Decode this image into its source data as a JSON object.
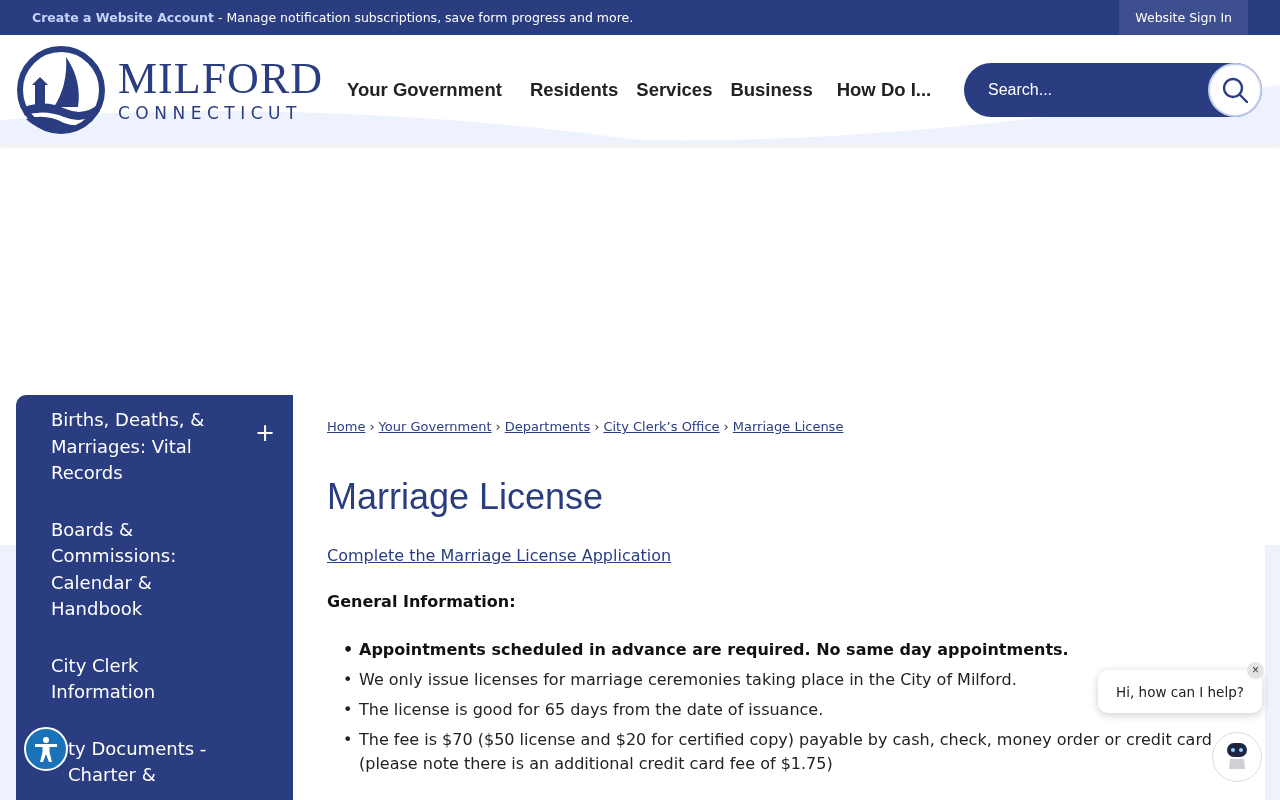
{
  "top_bar": {
    "account_link": "Create a Website Account",
    "account_note": "- Manage notification subscriptions, save form progress and more.",
    "sign_in": "Website Sign In"
  },
  "logo": {
    "name": "MILFORD",
    "state": "CONNECTICUT"
  },
  "nav": [
    "Your Government",
    "Residents",
    "Services",
    "Business",
    "How Do I..."
  ],
  "search": {
    "placeholder": "Search..."
  },
  "sidebar": {
    "items": [
      {
        "label": "Births, Deaths, & Marriages: Vital Records",
        "toggle": "+"
      },
      {
        "label": "Boards & Commissions: Calendar & Handbook"
      },
      {
        "label": "City Clerk Information"
      },
      {
        "label": "ty Documents - Charter &"
      }
    ]
  },
  "breadcrumb": [
    "Home",
    "Your Government",
    "Departments",
    "City Clerk’s Office",
    "Marriage License"
  ],
  "breadcrumb_separator": "›",
  "page_title": "Marriage License",
  "application_link": "Complete the Marriage License Application",
  "section_heading": "General Information:",
  "bullet_marker": "•",
  "bullets": [
    {
      "text": "Appointments scheduled in advance are required. No same day appointments.",
      "emphasis": true
    },
    {
      "text": "We only issue licenses for marriage ceremonies taking place in the City of Milford.",
      "emphasis": false
    },
    {
      "text": "The license is good for 65 days from the date of issuance.",
      "emphasis": false
    },
    {
      "text": "The fee is $70 ($50 license and $20 for certified copy) payable by cash, check, money order or credit card (please note there is an additional credit card fee of $1.75)",
      "emphasis": false
    }
  ],
  "chat": {
    "greeting": "Hi, how can I help?",
    "close": "×"
  }
}
